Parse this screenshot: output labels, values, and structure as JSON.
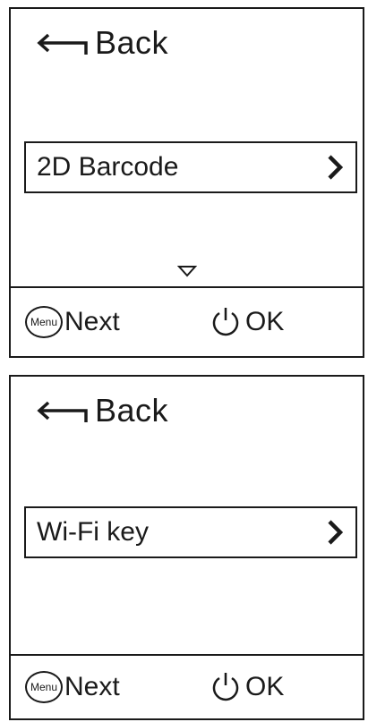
{
  "screens": [
    {
      "back_label": "Back",
      "item_label": "2D Barcode",
      "footer": {
        "menu_icon_label": "Menu",
        "next_label": "Next",
        "ok_label": "OK"
      },
      "icons": [
        "back-arrow-icon",
        "chevron-right-icon",
        "down-triangle-icon",
        "menu-button-icon",
        "power-icon"
      ]
    },
    {
      "back_label": "Back",
      "item_label": "Wi-Fi key",
      "footer": {
        "menu_icon_label": "Menu",
        "next_label": "Next",
        "ok_label": "OK"
      },
      "icons": [
        "back-arrow-icon",
        "chevron-right-icon",
        "menu-button-icon",
        "power-icon"
      ]
    }
  ]
}
